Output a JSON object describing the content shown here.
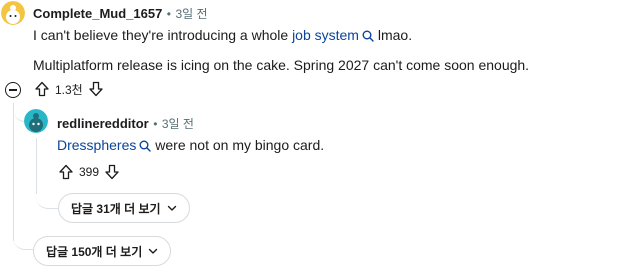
{
  "comment1": {
    "username": "Complete_Mud_1657",
    "dot": "•",
    "time": "3일 전",
    "line1_before": "I can't believe they're introducing a whole ",
    "line1_link": "job system",
    "line1_after": " lmao.",
    "line2": "Multiplatform release is icing on the cake. Spring 2027 can't come soon enough.",
    "votes": "1.3천",
    "avatar_color": "#f4c542"
  },
  "comment2": {
    "username": "redlineredditor",
    "dot": "•",
    "time": "3일 전",
    "text_link": "Dresspheres",
    "text_after": " were not on my bingo card.",
    "votes": "399",
    "avatar_color": "#29b6c6"
  },
  "buttons": {
    "replies_31": "답글 31개 더 보기",
    "replies_150": "답글 150개 더 보기"
  },
  "colors": {
    "link": "#0a449b",
    "meta": "#576f76",
    "thread_line": "#dbe2e5"
  },
  "icons": [
    "upvote-icon",
    "downvote-icon",
    "magnify-icon",
    "chevron-down-icon",
    "collapse-icon"
  ]
}
